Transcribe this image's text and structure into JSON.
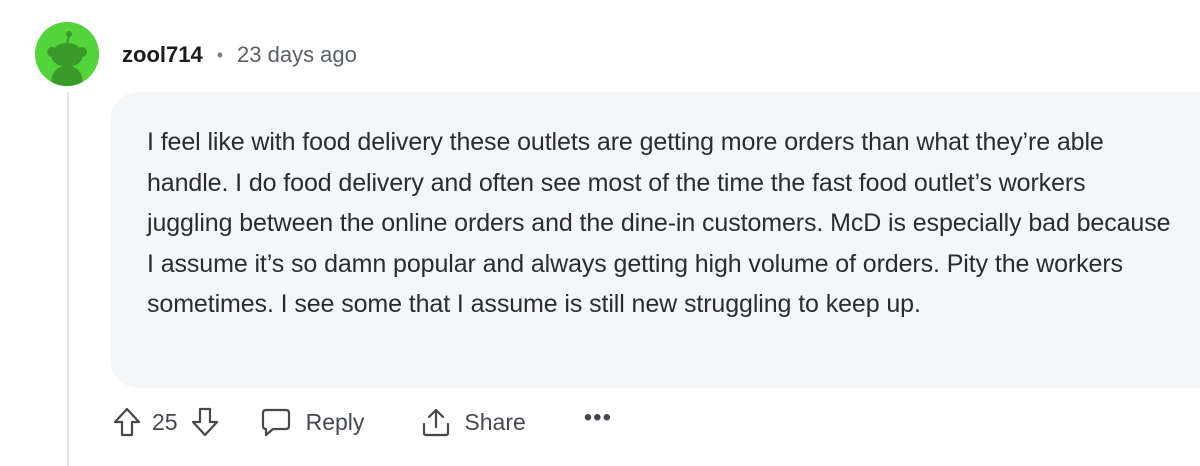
{
  "comment": {
    "author": "zool714",
    "separator": "•",
    "timestamp": "23 days ago",
    "avatar_color": "#54d43c",
    "body": "I feel like with food delivery these outlets are getting more orders than what they’re able handle. I do food delivery and often see most of the time the fast food outlet’s workers juggling between the online orders and the dine-in customers. McD is especially bad because I assume it’s so damn popular and always getting high volume of orders. Pity the workers sometimes. I see some that I assume is still new struggling to keep up."
  },
  "actions": {
    "upvote_icon": "arrow-up-icon",
    "vote_count": "25",
    "downvote_icon": "arrow-down-icon",
    "reply_icon": "speech-bubble-icon",
    "reply_label": "Reply",
    "share_icon": "share-upload-icon",
    "share_label": "Share",
    "more_label": "•••"
  }
}
